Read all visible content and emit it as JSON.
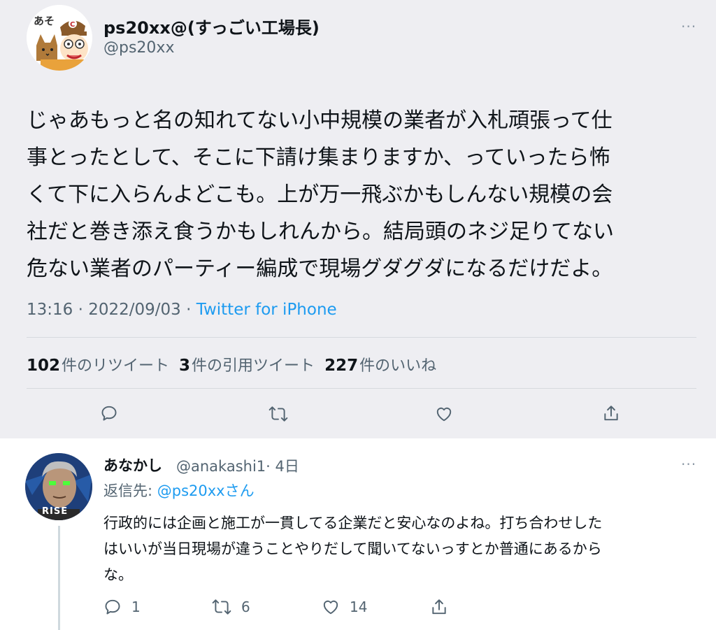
{
  "main_tweet": {
    "display_name": "ps20xx@(すっごい工場長)",
    "handle": "@ps20xx",
    "more": "···",
    "text_lines": [
      "じゃあもっと名の知れてない小中規模の業者が入札頑張って仕",
      "事とったとして、そこに下請け集まりますか、っていったら怖",
      "くて下に入らんよどこも。上が万一飛ぶかもしんない規模の会",
      "社だと巻き添え食うかもしれんから。結局頭のネジ足りてない",
      "危ない業者のパーティー編成で現場グダグダになるだけだよ。"
    ],
    "time": "13:16 · 2022/09/03 · ",
    "source": "Twitter for iPhone",
    "stats": {
      "retweets_count": "102",
      "retweets_label": "件のリツイート",
      "quotes_count": "3",
      "quotes_label": "件の引用ツイート",
      "likes_count": "227",
      "likes_label": "件のいいね"
    },
    "avatar_text": "あそ"
  },
  "reply": {
    "display_name": "あなかし",
    "handle": "@anakashi1",
    "time": "· 4日",
    "more": "···",
    "reply_to_prefix": "返信先: ",
    "reply_to_mention": "@ps20xx",
    "reply_to_suffix": "さん",
    "text_lines": [
      "行政的には企画と施工が一貫してる企業だと安心なのよね。打ち合わせした",
      "はいいが当日現場が違うことやりだして聞いてないっすとか普通にあるから",
      "な。"
    ],
    "counts": {
      "replies": "1",
      "retweets": "6",
      "likes": "14"
    },
    "avatar_text": "RISE"
  },
  "colors": {
    "background_main": "#eeeef2",
    "link": "#1d9bf0",
    "secondary_text": "#536471"
  }
}
